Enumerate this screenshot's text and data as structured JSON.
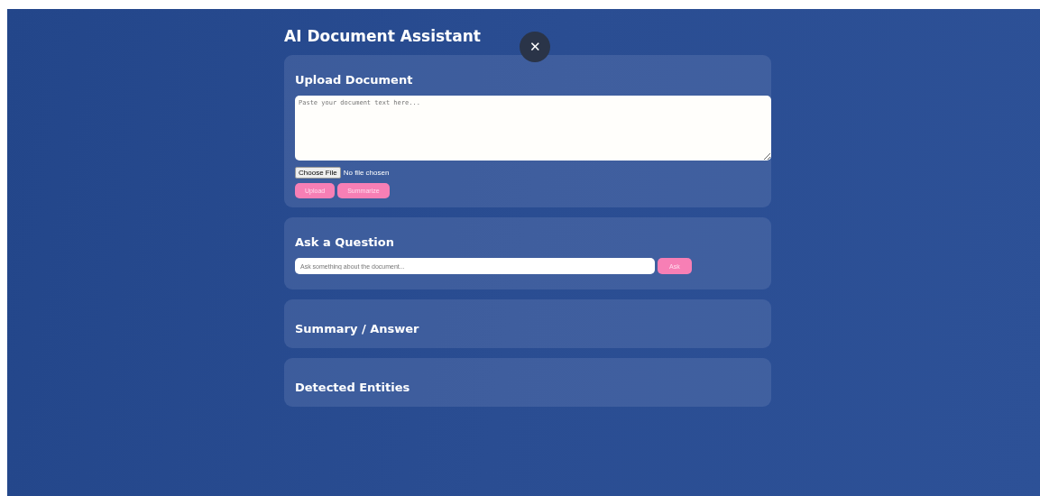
{
  "title": "AI Document Assistant",
  "close_button": {
    "label": "✕"
  },
  "sections": [
    {
      "kind": "upload",
      "heading": "Upload Document",
      "textarea": {
        "placeholder": "Paste your document text here..."
      },
      "file_input": {
        "button": "Choose File",
        "status": "No file chosen"
      },
      "buttons": [
        "Upload",
        "Summarize"
      ]
    },
    {
      "kind": "question",
      "heading": "Ask a Question",
      "input": {
        "placeholder": "Ask something about the document..."
      },
      "buttons": [
        "Ask"
      ]
    },
    {
      "kind": "result",
      "heading": "Summary / Answer"
    },
    {
      "kind": "result",
      "heading": "Detected Entities"
    }
  ]
}
